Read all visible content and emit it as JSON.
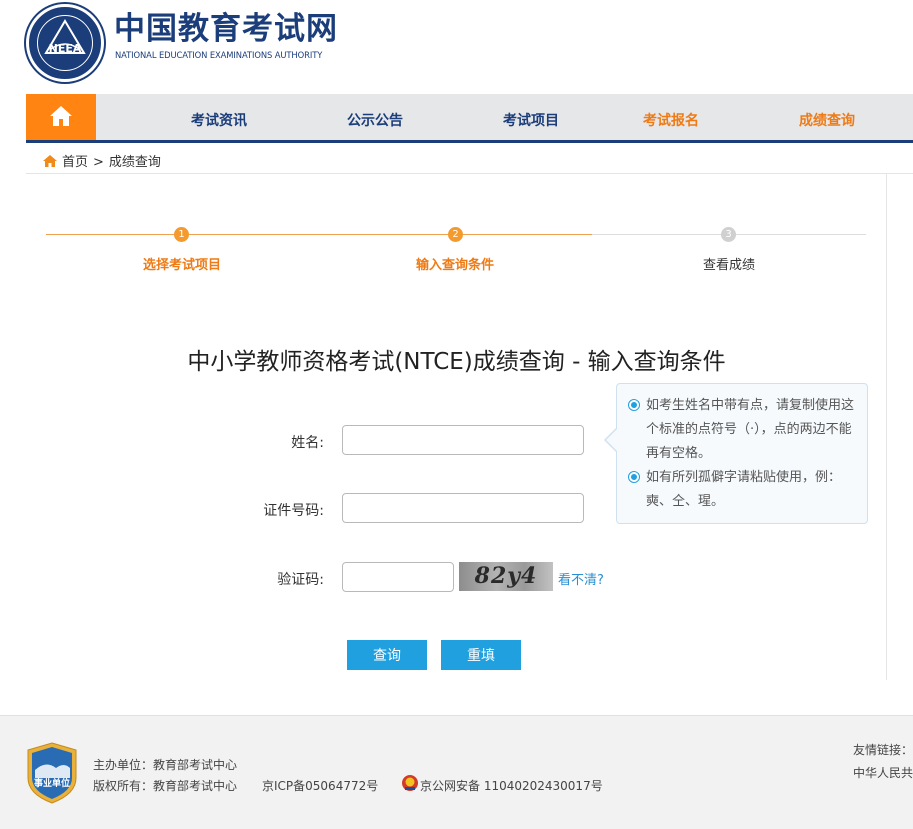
{
  "header": {
    "title": "中国教育考试网",
    "subtitle": "NATIONAL EDUCATION EXAMINATIONS AUTHORITY",
    "logo_text": "NEEA"
  },
  "nav": {
    "home_icon": "home-icon",
    "items": [
      {
        "label": "考试资讯"
      },
      {
        "label": "公示公告"
      },
      {
        "label": "考试项目"
      },
      {
        "label": "考试报名"
      },
      {
        "label": "成绩查询"
      }
    ]
  },
  "breadcrumb": {
    "home": "首页",
    "separator": ">",
    "current": "成绩查询"
  },
  "steps": [
    {
      "num": "1",
      "label": "选择考试项目",
      "state": "done"
    },
    {
      "num": "2",
      "label": "输入查询条件",
      "state": "active"
    },
    {
      "num": "3",
      "label": "查看成绩",
      "state": "todo"
    }
  ],
  "page_title": "中小学教师资格考试(NTCE)成绩查询 - 输入查询条件",
  "form": {
    "name_label": "姓名:",
    "name_value": "",
    "id_label": "证件号码:",
    "id_value": "",
    "captcha_label": "验证码:",
    "captcha_value": "",
    "captcha_text": "82y4",
    "refresh_link": "看不清?",
    "submit_label": "查询",
    "reset_label": "重填"
  },
  "tips": [
    {
      "text": "如考生姓名中带有点，请复制使用这个标准的点符号（·），点的两边不能再有空格。"
    },
    {
      "text": "如有所列孤僻字请粘贴使用，例：奭、仝、瑆。"
    }
  ],
  "footer": {
    "badge_text": "事业单位",
    "sponsor": "主办单位：教育部考试中心",
    "copyright": "版权所有：教育部考试中心",
    "icp": "京ICP备05064772号",
    "police": "京公网安备 11040202430017号",
    "links_label": "友情链接：",
    "links_item": "中华人民共"
  },
  "colors": {
    "brand": "#1b3d7a",
    "accent": "#ff8412",
    "button": "#21a0e0"
  }
}
